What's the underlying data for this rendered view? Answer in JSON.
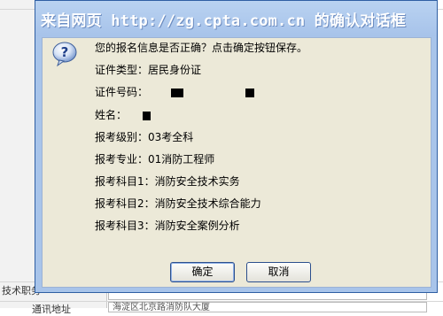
{
  "background": {
    "field_label_partial": "技术职务",
    "address_partial": "通讯地址",
    "address_value_partial": "海淀区北京路消防队大厦"
  },
  "dialog": {
    "title": "来自网页 http://zg.cpta.com.cn 的确认对话框",
    "icon": "question-icon",
    "prompt": "您的报名信息是否正确？点击确定按钮保存。",
    "id_type_label": "证件类型：居民身份证",
    "id_number_label": "证件号码：",
    "name_label": "姓名：",
    "level_label": "报考级别：03考全科",
    "major_label": "报考专业：01消防工程师",
    "subject1_label": "报考科目1：消防安全技术实务",
    "subject2_label": "报考科目2：消防安全技术综合能力",
    "subject3_label": "报考科目3：消防安全案例分析",
    "ok_label": "确定",
    "cancel_label": "取消"
  }
}
